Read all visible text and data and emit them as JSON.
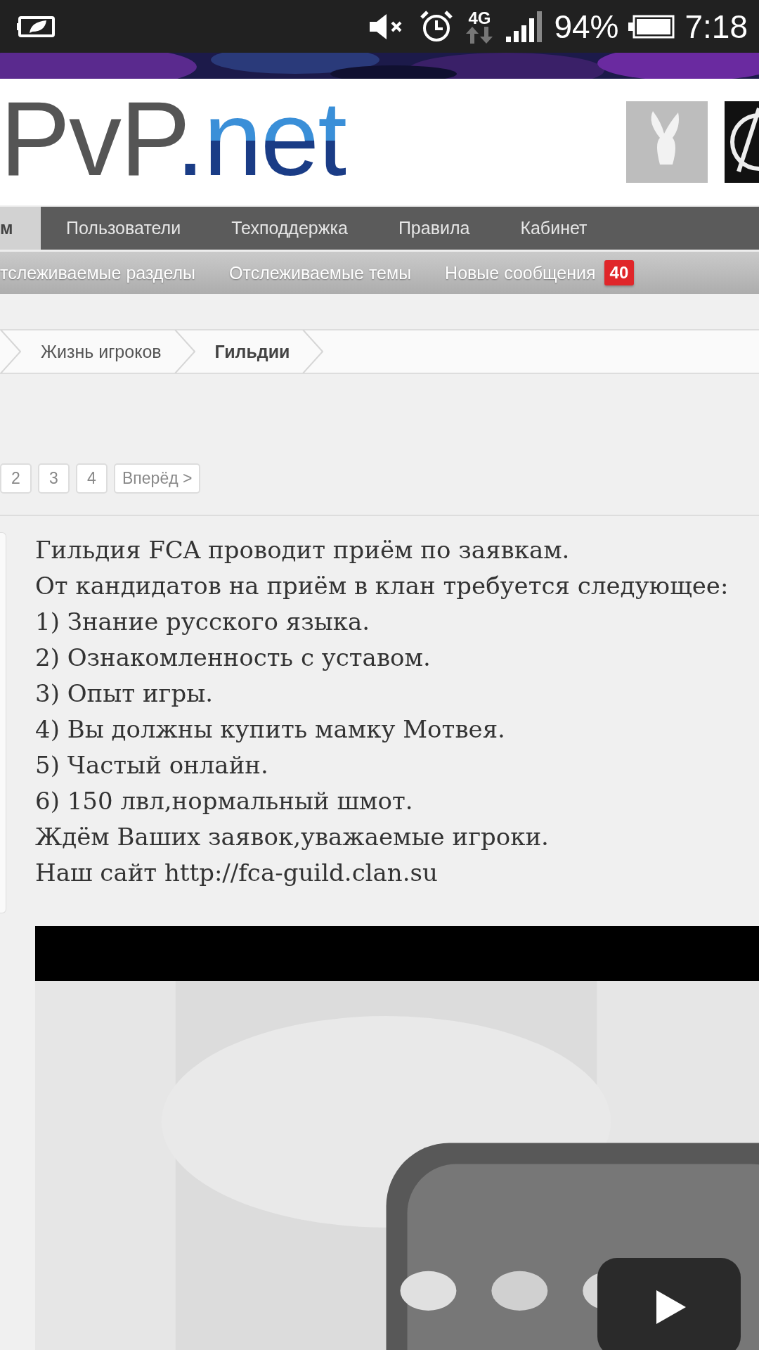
{
  "status_bar": {
    "network": "4G",
    "battery": "94%",
    "time": "7:18"
  },
  "header": {
    "logo_part_1": "PvP",
    "logo_part_2": ".net"
  },
  "nav": {
    "tabs": [
      {
        "label": "м",
        "selected": true
      },
      {
        "label": "Пользователи",
        "selected": false
      },
      {
        "label": "Техподдержка",
        "selected": false
      },
      {
        "label": "Правила",
        "selected": false
      },
      {
        "label": "Кабинет",
        "selected": false
      }
    ]
  },
  "subnav": {
    "items": [
      {
        "label": "тслеживаемые разделы"
      },
      {
        "label": "Отслеживаемые темы"
      },
      {
        "label": "Новые сообщения",
        "badge": "40"
      }
    ]
  },
  "breadcrumb": [
    {
      "label": "Жизнь игроков",
      "current": false
    },
    {
      "label": "Гильдии",
      "current": true
    }
  ],
  "pagination": [
    {
      "label": "2"
    },
    {
      "label": "3"
    },
    {
      "label": "4"
    },
    {
      "label": "Вперёд >"
    }
  ],
  "post": {
    "lines": [
      "Гильдия FCA проводит приём по заявкам.",
      "От кандидатов на приём в клан требуется следующее:",
      "1) Знание русского языка.",
      "2) Ознакомленность с уставом.",
      "3) Опыт игры.",
      "4) Вы должны купить мамку Мотвея.",
      "5) Частый онлайн.",
      "6) 150 лвл,нормальный шмот.",
      "Ждём Ваших заявок,уважаемые игроки.",
      "Наш сайт http://fca-guild.clan.su"
    ]
  }
}
